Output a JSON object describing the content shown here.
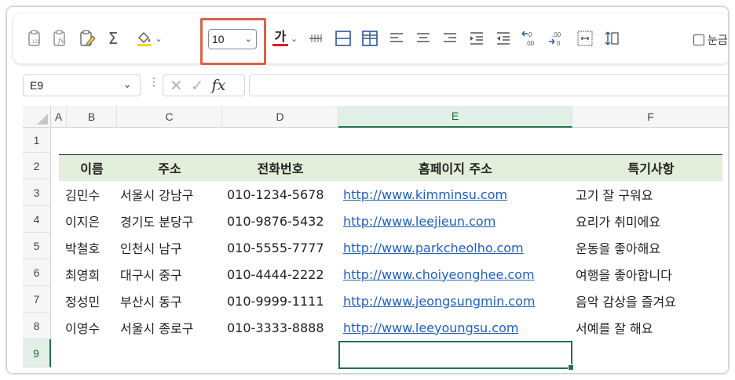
{
  "toolbar": {
    "font_size_value": "10",
    "dropdown_glyph": "⌄",
    "gridlines_label": "눈금",
    "font_color_letter": "가",
    "accent_red": "#e81123",
    "highlight_color": "#d9624a",
    "decimal_increase": ".00",
    "decimal_decrease": ".00"
  },
  "formula_bar": {
    "name_box": "E9",
    "fx_symbol": "fx",
    "formula": ""
  },
  "columns": [
    "A",
    "B",
    "C",
    "D",
    "E",
    "F"
  ],
  "rows": [
    "1",
    "2",
    "3",
    "4",
    "5",
    "6",
    "7",
    "8",
    "9"
  ],
  "selected": {
    "column": "E",
    "row": "9",
    "cell": "E9"
  },
  "table": {
    "headers": [
      "이름",
      "주소",
      "전화번호",
      "홈페이지 주소",
      "특기사항"
    ],
    "rows": [
      [
        "김민수",
        "서울시 강남구",
        "010-1234-5678",
        "http://www.kimminsu.com",
        "고기 잘 구워요"
      ],
      [
        "이지은",
        "경기도 분당구",
        "010-9876-5432",
        "http://www.leejieun.com",
        "요리가 취미에요"
      ],
      [
        "박철호",
        "인천시 남구",
        "010-5555-7777",
        "http://www.parkcheolho.com",
        "운동을 좋아해요"
      ],
      [
        "최영희",
        "대구시 중구",
        "010-4444-2222",
        "http://www.choiyeonghee.com",
        "여행을 좋아합니다"
      ],
      [
        "정성민",
        "부산시 동구",
        "010-9999-1111",
        "http://www.jeongsungmin.com",
        "음악 감상을 즐겨요"
      ],
      [
        "이영수",
        "서울시 종로구",
        "010-3333-8888",
        "http://www.leeyoungsu.com",
        "서예를 잘 해요"
      ]
    ],
    "header_fill": "#e3efda",
    "link_color": "#1f5fbf"
  }
}
